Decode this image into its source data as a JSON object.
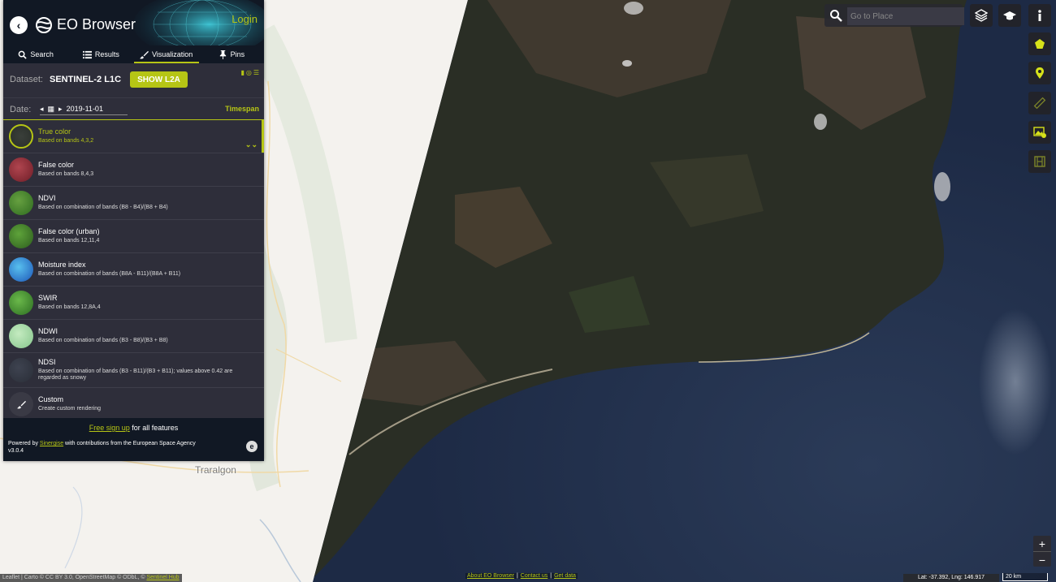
{
  "header": {
    "app_title": "EO Browser",
    "login": "Login"
  },
  "tabs": [
    {
      "label": "Search",
      "icon": "search-icon"
    },
    {
      "label": "Results",
      "icon": "list-icon"
    },
    {
      "label": "Visualization",
      "icon": "brush-icon",
      "active": true
    },
    {
      "label": "Pins",
      "icon": "pin-icon"
    }
  ],
  "dataset": {
    "label": "Dataset:",
    "name": "SENTINEL-2 L1C",
    "l2a_button": "SHOW L2A"
  },
  "date": {
    "label": "Date:",
    "value": "2019-11-01",
    "timespan": "Timespan"
  },
  "layers": [
    {
      "name": "True color",
      "desc": "Based on bands 4,3,2",
      "active": true
    },
    {
      "name": "False color",
      "desc": "Based on bands 8,4,3"
    },
    {
      "name": "NDVI",
      "desc": "Based on combination of bands (B8 - B4)/(B8 + B4)"
    },
    {
      "name": "False color (urban)",
      "desc": "Based on bands 12,11,4"
    },
    {
      "name": "Moisture index",
      "desc": "Based on combination of bands (B8A - B11)/(B8A + B11)"
    },
    {
      "name": "SWIR",
      "desc": "Based on bands 12,8A,4"
    },
    {
      "name": "NDWI",
      "desc": "Based on combination of bands (B3 - B8)/(B3 + B8)"
    },
    {
      "name": "NDSI",
      "desc": "Based on combination of bands (B3 - B11)/(B3 + B11); values above 0.42 are regarded as snowy"
    },
    {
      "name": "Custom",
      "desc": "Create custom rendering"
    }
  ],
  "footer": {
    "signup_link": "Free sign up",
    "signup_rest": " for all features",
    "powered_prefix": "Powered by ",
    "sinergise": "Sinergise",
    "powered_suffix": " with contributions from the European Space Agency",
    "version": "v3.0.4"
  },
  "map": {
    "place_label": "Traralgon",
    "search_placeholder": "Go to Place",
    "coords": "Lat: -37.392, Lng: 146.917",
    "scale": "20 km",
    "zoom_in": "+",
    "zoom_out": "−"
  },
  "attribution": {
    "text": "Leaflet | Carto © CC BY 3.0, OpenStreetMap © ODbL, © ",
    "link": "Sentinel Hub"
  },
  "bottom_links": [
    "About EO Browser",
    "Contact us",
    "Get data"
  ],
  "colors": {
    "accent": "#b6c515",
    "panel": "#2e2e3a",
    "header": "#111824"
  }
}
